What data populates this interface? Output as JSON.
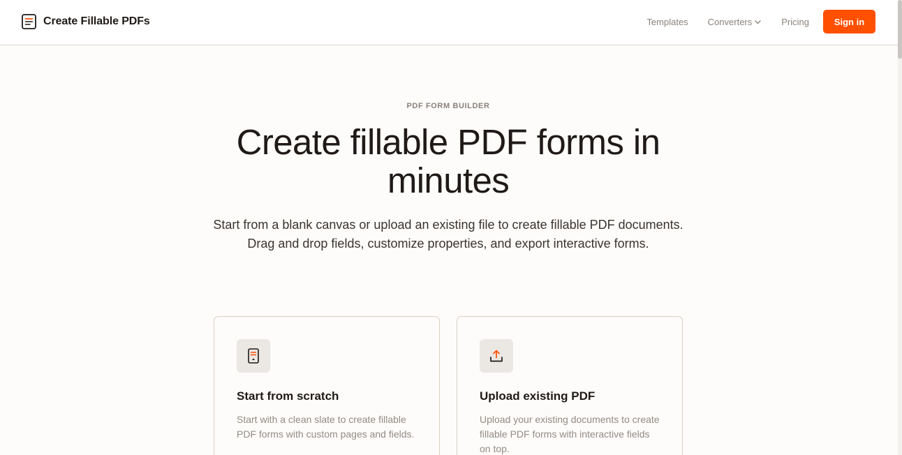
{
  "header": {
    "brand_name": "Create Fillable PDFs",
    "nav": {
      "templates": "Templates",
      "converters": "Converters",
      "pricing": "Pricing",
      "sign_in": "Sign in"
    }
  },
  "hero": {
    "eyebrow": "PDF FORM BUILDER",
    "headline": "Create fillable PDF forms in minutes",
    "subtext": "Start from a blank canvas or upload an existing file to create fillable PDF documents. Drag and drop fields, customize properties, and export interactive forms."
  },
  "cards": [
    {
      "icon": "document-icon",
      "title": "Start from scratch",
      "description": "Start with a clean slate to create fillable PDF forms with custom pages and fields."
    },
    {
      "icon": "upload-icon",
      "title": "Upload existing PDF",
      "description": "Upload your existing documents to create fillable PDF forms with interactive fields on top."
    }
  ],
  "colors": {
    "accent": "#ff4f00",
    "background": "#fdfcfa",
    "text": "#1f1a17",
    "muted": "#8a827b",
    "card_border": "#d9cfc3"
  }
}
